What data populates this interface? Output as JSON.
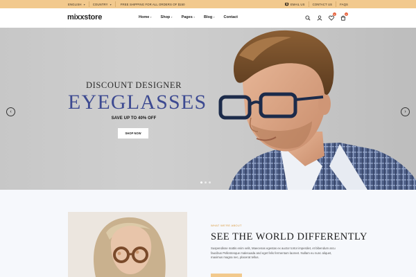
{
  "topbar": {
    "language": "ENGLISH",
    "country": "COUNTRY",
    "shipping": "FREE SHIPPING FOR ALL ORDERS OF $150",
    "email": "EMAIL US",
    "contact": "CONTACT US",
    "faqs": "FAQS"
  },
  "header": {
    "logo": "mixxstore",
    "nav": [
      {
        "label": "Home",
        "dropdown": true
      },
      {
        "label": "Shop",
        "dropdown": true
      },
      {
        "label": "Pages",
        "dropdown": true
      },
      {
        "label": "Blog",
        "dropdown": true
      },
      {
        "label": "Contact",
        "dropdown": false
      }
    ],
    "wishlist_count": "0",
    "cart_count": "0"
  },
  "hero": {
    "subtitle": "DISCOUNT DESIGNER",
    "title": "EYEGLASSES",
    "offer": "SAVE UP TO 40% OFF",
    "button": "SHOP NOW",
    "title_color": "#3d4a91",
    "slides": 3,
    "active_slide": 0
  },
  "about": {
    "tag": "WHAT WE'RE ABOUT",
    "title": "SEE THE WORLD DIFFERENTLY",
    "body": "Suspendisse mattis enim velit, Maecenas egestas ex auctor tortor imperdiet, et bibendum arcu faucibus Pellentesque malesuada and eget felis fermentum laoreet. Nullam eu nunc aliquet, maximus magna nec, placerat tellus.",
    "accent_color": "#f2c98d"
  }
}
